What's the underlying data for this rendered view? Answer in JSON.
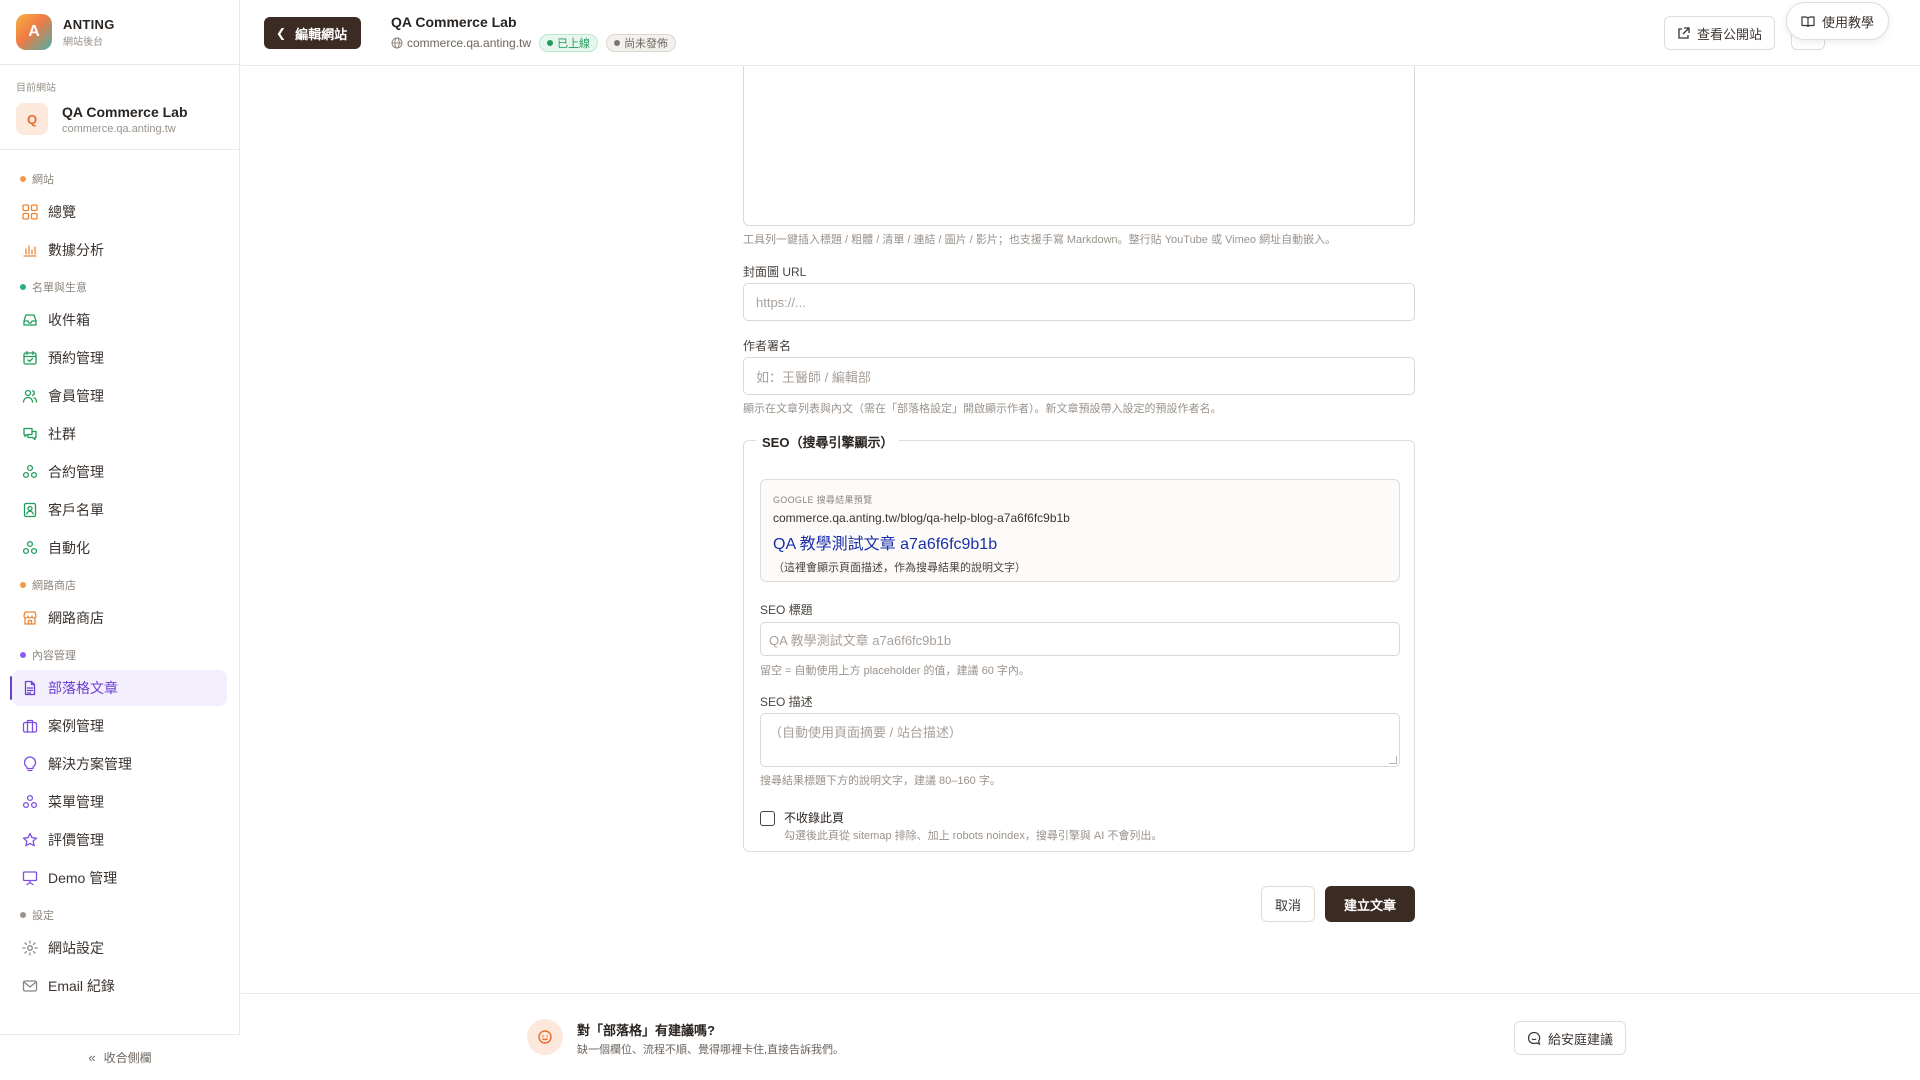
{
  "brand": {
    "logo_letter": "A",
    "name": "ANTING",
    "subtitle": "網站後台"
  },
  "current_site": {
    "caption": "目前網站",
    "avatar_letter": "Q",
    "name": "QA Commerce Lab",
    "domain": "commerce.qa.anting.tw"
  },
  "sidebar": {
    "sections": [
      {
        "label": "網站",
        "color": "#f29a4a",
        "items": [
          {
            "label": "總覽",
            "icon": "grid-icon"
          },
          {
            "label": "數據分析",
            "icon": "bar-chart-icon"
          }
        ]
      },
      {
        "label": "名單與生意",
        "color": "#2ab07a",
        "items": [
          {
            "label": "收件箱",
            "icon": "inbox-icon"
          },
          {
            "label": "預約管理",
            "icon": "calendar-icon"
          },
          {
            "label": "會員管理",
            "icon": "users-icon"
          },
          {
            "label": "社群",
            "icon": "chat-icon"
          },
          {
            "label": "合約管理",
            "icon": "cluster-icon"
          },
          {
            "label": "客戶名單",
            "icon": "contact-icon"
          },
          {
            "label": "自動化",
            "icon": "cluster-icon"
          }
        ]
      },
      {
        "label": "網路商店",
        "color": "#f29a4a",
        "items": [
          {
            "label": "網路商店",
            "icon": "store-icon"
          }
        ]
      },
      {
        "label": "內容管理",
        "color": "#8b5cf6",
        "items": [
          {
            "label": "部落格文章",
            "icon": "document-icon",
            "active": true
          },
          {
            "label": "案例管理",
            "icon": "briefcase-icon"
          },
          {
            "label": "解決方案管理",
            "icon": "lightbulb-icon"
          },
          {
            "label": "菜單管理",
            "icon": "cluster-icon"
          },
          {
            "label": "評價管理",
            "icon": "star-icon"
          },
          {
            "label": "Demo 管理",
            "icon": "presentation-icon"
          }
        ]
      },
      {
        "label": "設定",
        "color": "#9a928b",
        "items": [
          {
            "label": "網站設定",
            "icon": "gear-icon"
          },
          {
            "label": "Email 紀錄",
            "icon": "mail-icon"
          }
        ]
      }
    ],
    "collapse_label": "收合側欄"
  },
  "topbar": {
    "back_label": "編輯網站",
    "site_title": "QA Commerce Lab",
    "site_domain": "commerce.qa.anting.tw",
    "badge_live": "已上線",
    "badge_draft": "尚未發佈",
    "public_site_label": "查看公開站",
    "tutorial_label": "使用教學"
  },
  "form": {
    "editor_hint": "工具列一鍵插入標題 / 粗體 / 清單 / 連結 / 圖片 / 影片；也支援手寫 Markdown。整行貼 YouTube 或 Vimeo 網址自動嵌入。",
    "cover_label": "封面圖 URL",
    "cover_placeholder": "https://...",
    "author_label": "作者署名",
    "author_placeholder": "如：王醫師 / 編輯部",
    "author_hint": "顯示在文章列表與內文（需在「部落格設定」開啟顯示作者）。新文章預設帶入設定的預設作者名。",
    "seo": {
      "legend": "SEO（搜尋引擎顯示）",
      "preview_caption": "GOOGLE 搜尋結果預覽",
      "preview_url": "commerce.qa.anting.tw/blog/qa-help-blog-a7a6f6fc9b1b",
      "preview_title": "QA 教學測試文章 a7a6f6fc9b1b",
      "preview_desc": "（這裡會顯示頁面描述，作為搜尋結果的說明文字）",
      "title_label": "SEO 標題",
      "title_placeholder": "QA 教學測試文章 a7a6f6fc9b1b",
      "title_hint": "留空 = 自動使用上方 placeholder 的值，建議 60 字內。",
      "desc_label": "SEO 描述",
      "desc_placeholder": "（自動使用頁面摘要 / 站台描述）",
      "desc_hint": "搜尋結果標題下方的說明文字，建議 80–160 字。",
      "noindex_label": "不收錄此頁",
      "noindex_hint": "勾選後此頁從 sitemap 排除、加上 robots noindex，搜尋引擎與 AI 不會列出。",
      "noindex_checked": false
    },
    "cancel_label": "取消",
    "submit_label": "建立文章"
  },
  "feedback": {
    "title": "對「部落格」有建議嗎?",
    "subtitle": "缺一個欄位、流程不順、覺得哪裡卡住,直接告訴我們。",
    "button_label": "給安庭建議"
  }
}
